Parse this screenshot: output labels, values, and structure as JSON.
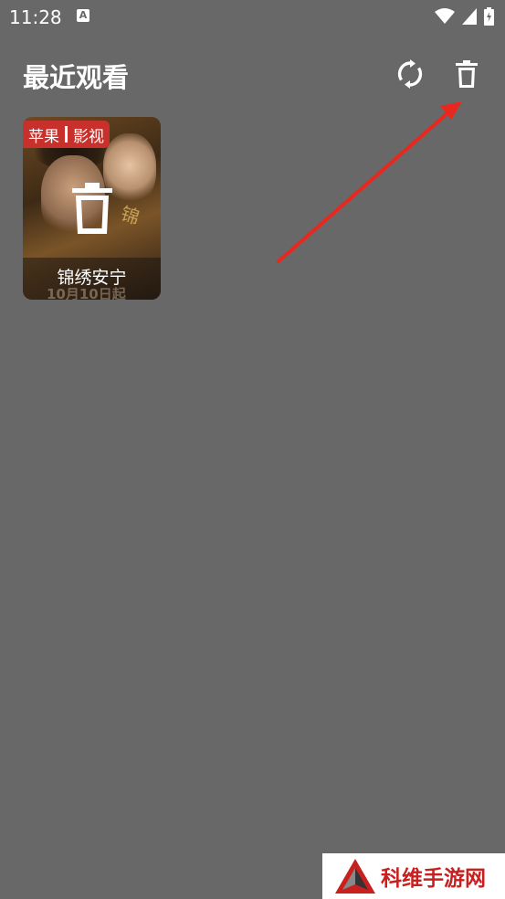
{
  "status_bar": {
    "time": "11:28",
    "app_indicator": "A"
  },
  "header": {
    "title": "最近观看",
    "refresh_icon": "refresh-icon",
    "delete_icon": "trash-icon"
  },
  "history": [
    {
      "title": "锦绣安宁",
      "badge_left": "苹果",
      "badge_right": "影视",
      "poster_date": "10月10日起",
      "poster_glyph": "锦",
      "overlay_icon": "trash-icon"
    }
  ],
  "watermark": {
    "text": "科维手游网"
  },
  "colors": {
    "background": "#686868",
    "badge": "#c8312b",
    "arrow": "#e8281f",
    "watermark_text": "#c8201f"
  }
}
